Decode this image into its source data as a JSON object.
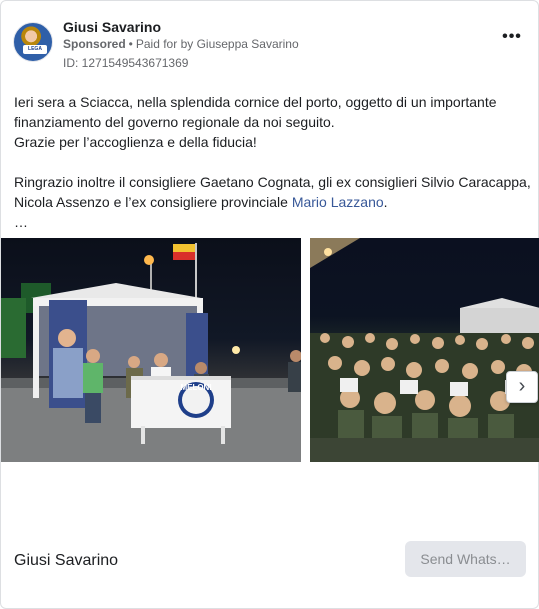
{
  "ad": {
    "page_name": "Giusi Savarino",
    "sponsored_label": "Sponsored",
    "separator": "•",
    "paid_for": "Paid for by Giuseppa Savarino",
    "ad_id": "ID: 1271549543671369",
    "more_icon": "more-horizontal-icon",
    "avatar_badge": "LEGA"
  },
  "post": {
    "lines": [
      "Ieri sera a Sciacca, nella splendida cornice del porto, oggetto di un importante",
      "finanziamento del governo regionale da noi seguito.",
      "Grazie per l’accoglienza e della fiducia!"
    ],
    "lines2_a": "Ringrazio inoltre il consigliere Gaetano Cognata, gli ex consiglieri Silvio Caracappa,",
    "lines2_b": "Nicola Assenzo e l’ex consigliere provinciale ",
    "mention": "Mario Lazzano",
    "mention_suffix": ".",
    "ellipsis": "…"
  },
  "carousel": {
    "banner_text": "MELONI",
    "next_icon": "chevron-right-icon"
  },
  "footer": {
    "name": "Giusi Savarino",
    "cta_label": "Send Whats…"
  }
}
